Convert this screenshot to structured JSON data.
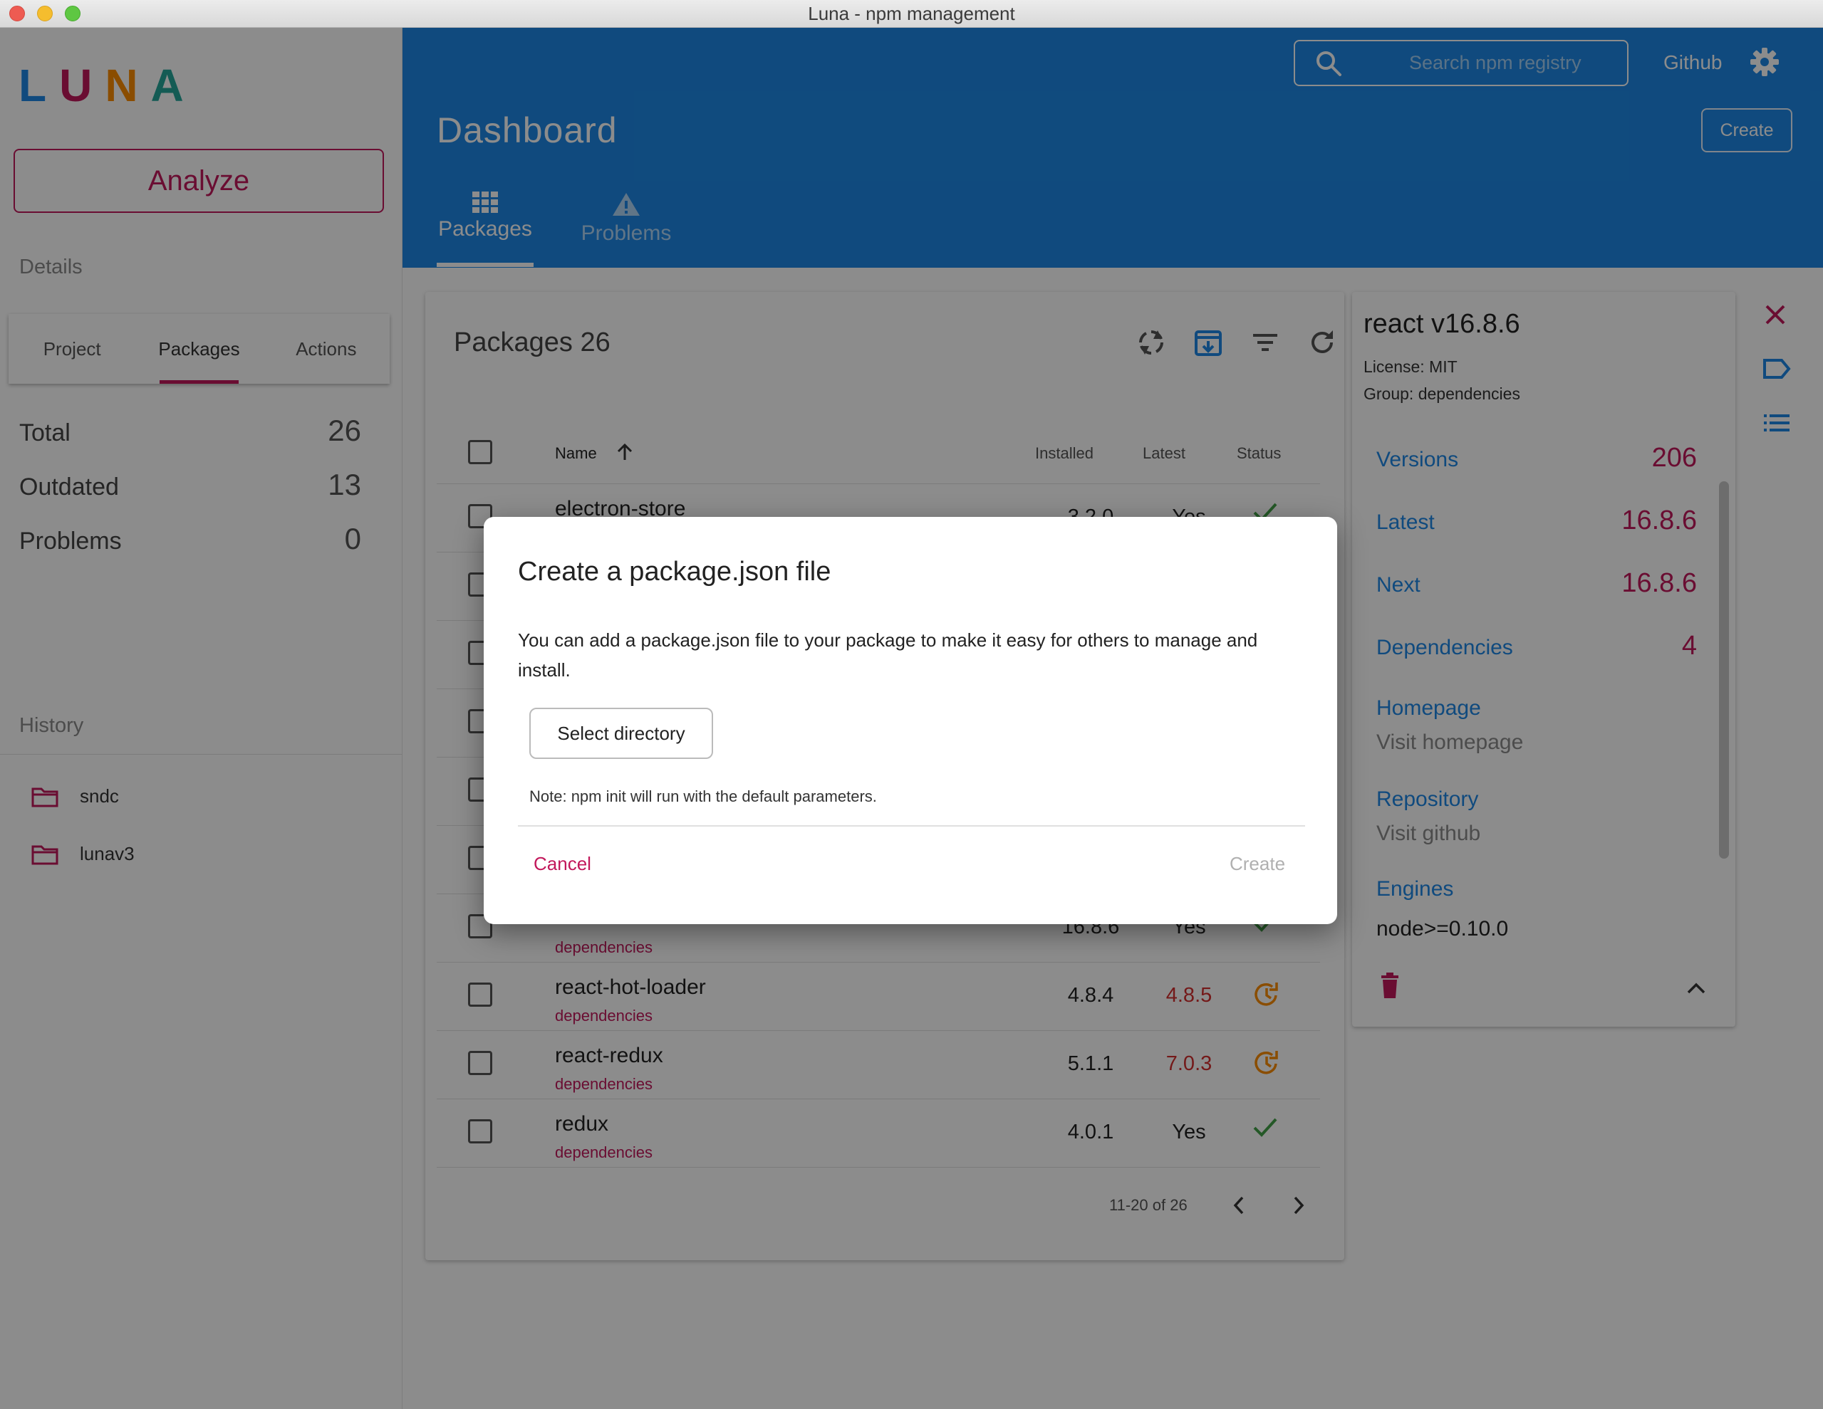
{
  "window": {
    "title": "Luna - npm management"
  },
  "sidebar": {
    "logo_letters": [
      "L",
      "U",
      "N",
      "A"
    ],
    "analyze_label": "Analyze",
    "details_label": "Details",
    "tabs": [
      "Project",
      "Packages",
      "Actions"
    ],
    "active_tab": "Packages",
    "stats": [
      {
        "label": "Total",
        "value": "26"
      },
      {
        "label": "Outdated",
        "value": "13"
      },
      {
        "label": "Problems",
        "value": "0"
      }
    ],
    "history_label": "History",
    "history": [
      "sndc",
      "lunav3"
    ]
  },
  "header": {
    "search_placeholder": "Search npm registry",
    "github_label": "Github",
    "title": "Dashboard",
    "create_label": "Create",
    "tabs": [
      {
        "label": "Packages",
        "icon": "grid-icon"
      },
      {
        "label": "Problems",
        "icon": "warning-icon"
      }
    ]
  },
  "packages": {
    "title": "Packages 26",
    "columns": {
      "name": "Name",
      "installed": "Installed",
      "latest": "Latest",
      "status": "Status"
    },
    "rows": [
      {
        "name": "electron-store",
        "group": "",
        "installed": "3.2.0",
        "latest": "Yes",
        "status": "ok"
      },
      {
        "name": "",
        "group": "dependencies",
        "installed": "16.8.6",
        "latest": "Yes",
        "status": "ok"
      },
      {
        "name": "react-hot-loader",
        "group": "dependencies",
        "installed": "4.8.4",
        "latest": "4.8.5",
        "status": "outdated"
      },
      {
        "name": "react-redux",
        "group": "dependencies",
        "installed": "5.1.1",
        "latest": "7.0.3",
        "status": "outdated"
      },
      {
        "name": "redux",
        "group": "dependencies",
        "installed": "4.0.1",
        "latest": "Yes",
        "status": "ok"
      }
    ],
    "pagination": "11-20 of 26"
  },
  "details": {
    "title": "react v16.8.6",
    "license": "License: MIT",
    "group": "Group: dependencies",
    "rows": [
      {
        "label": "Versions",
        "value": "206"
      },
      {
        "label": "Latest",
        "value": "16.8.6"
      },
      {
        "label": "Next",
        "value": "16.8.6"
      },
      {
        "label": "Dependencies",
        "value": "4"
      }
    ],
    "homepage_label": "Homepage",
    "homepage_link": "Visit homepage",
    "repository_label": "Repository",
    "repository_link": "Visit github",
    "engines_label": "Engines",
    "engines_value": "node>=0.10.0"
  },
  "dialog": {
    "title": "Create a package.json file",
    "body": "You can add a package.json file to your package to make it easy for others to manage and install.",
    "select_label": "Select directory",
    "note": "Note: npm init will run with the default parameters.",
    "cancel_label": "Cancel",
    "create_label": "Create"
  },
  "colors": {
    "primary": "#1e88e5",
    "accent": "#c2185b",
    "ok": "#43a047",
    "warn": "#fb8c00",
    "outdated_text": "#d32f2f"
  }
}
